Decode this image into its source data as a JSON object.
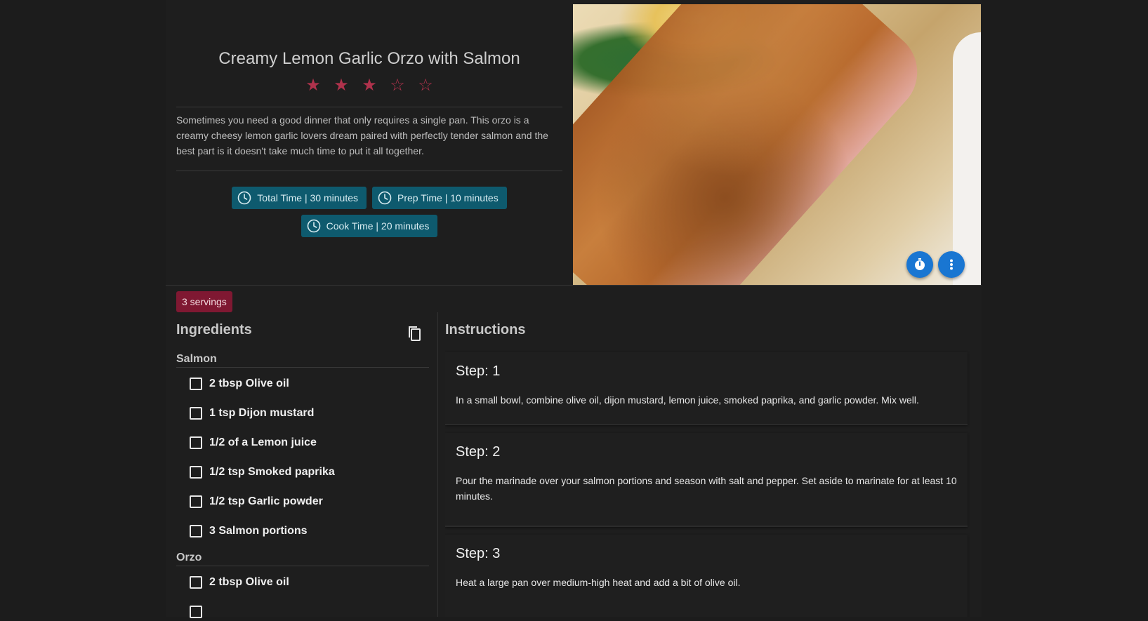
{
  "recipe": {
    "title": "Creamy Lemon Garlic Orzo with Salmon",
    "rating": 3,
    "rating_max": 5,
    "description": "Sometimes you need a good dinner that only requires a single pan. This orzo is a creamy cheesy lemon garlic lovers dream paired with perfectly tender salmon and the best part is it doesn't take much time to put it all together.",
    "times": [
      {
        "label": "Total Time | 30 minutes"
      },
      {
        "label": "Prep Time | 10 minutes"
      },
      {
        "label": "Cook Time | 20 minutes"
      }
    ],
    "servings": "3 servings"
  },
  "colors": {
    "star": "#b0324c",
    "chip_bg": "#0e5a6e",
    "servings_bg": "#7f1832",
    "fab": "#1976d2"
  },
  "icons": {
    "timer_button": "timer-icon",
    "more_button": "more-vert-icon",
    "copy_button": "copy-icon",
    "chip_icon": "clock-icon"
  },
  "ingredients": {
    "heading": "Ingredients",
    "groups": [
      {
        "title": "Salmon",
        "items": [
          {
            "text": "2 tbsp Olive oil",
            "checked": false
          },
          {
            "text": "1 tsp Dijon mustard",
            "checked": false
          },
          {
            "text": "1/2 of a Lemon juice",
            "checked": false
          },
          {
            "text": "1/2 tsp Smoked paprika",
            "checked": false
          },
          {
            "text": "1/2 tsp Garlic powder",
            "checked": false
          },
          {
            "text": "3 Salmon portions",
            "checked": false
          }
        ]
      },
      {
        "title": "Orzo",
        "items": [
          {
            "text": "2 tbsp Olive oil",
            "checked": false
          }
        ]
      }
    ]
  },
  "instructions": {
    "heading": "Instructions",
    "steps": [
      {
        "title": "Step: 1",
        "text": "In a small bowl, combine olive oil, dijon mustard, lemon juice, smoked paprika, and garlic powder. Mix well."
      },
      {
        "title": "Step: 2",
        "text": "Pour the marinade over your salmon portions and season with salt and pepper. Set aside to marinate for at least 10 minutes."
      },
      {
        "title": "Step: 3",
        "text": "Heat a large pan over medium-high heat and add a bit of olive oil."
      }
    ]
  }
}
